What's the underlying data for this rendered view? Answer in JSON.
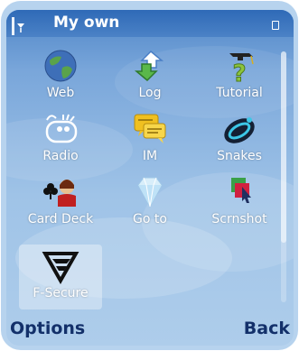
{
  "header": {
    "title": "My own"
  },
  "apps": [
    {
      "label": "Web",
      "icon": "globe-icon"
    },
    {
      "label": "Log",
      "icon": "log-arrows-icon"
    },
    {
      "label": "Tutorial",
      "icon": "tutorial-question-icon"
    },
    {
      "label": "Radio",
      "icon": "radio-icon"
    },
    {
      "label": "IM",
      "icon": "chat-bubbles-icon"
    },
    {
      "label": "Snakes",
      "icon": "snakes-icon"
    },
    {
      "label": "Card Deck",
      "icon": "card-deck-icon"
    },
    {
      "label": "Go to",
      "icon": "diamond-icon"
    },
    {
      "label": "Scrnshot",
      "icon": "screenshot-icon"
    },
    {
      "label": "F-Secure",
      "icon": "f-secure-logo-icon",
      "selected": true
    }
  ],
  "softkeys": {
    "left": "Options",
    "right": "Back"
  },
  "colors": {
    "title_bar": "#2f6ab7",
    "softkey_text": "#13306a",
    "frame": "#b7d3ee"
  }
}
